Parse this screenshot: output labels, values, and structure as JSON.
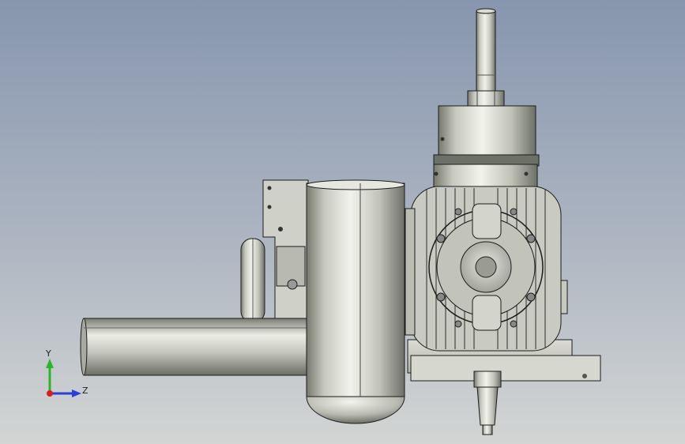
{
  "viewport": {
    "background_top": "#8796ae",
    "background_bottom": "#d3d5d4"
  },
  "model": {
    "parts": [
      "output-shaft",
      "hex-nut",
      "bearing-housing",
      "cooling-fin-cylinder",
      "muffler",
      "exhaust-pipe",
      "carburetor-bracket",
      "mount-plate",
      "crankcase"
    ],
    "colors": {
      "metal_light": "#e9eae3",
      "metal_mid": "#b9bbb1",
      "metal_dark": "#6f726a",
      "edge": "#1c1c1c"
    }
  },
  "triad": {
    "x_label": "",
    "y_label": "Y",
    "z_label": "Z",
    "y_color": "#2bb52b",
    "z_color": "#2b3fd6",
    "x_color": "#d62020"
  }
}
